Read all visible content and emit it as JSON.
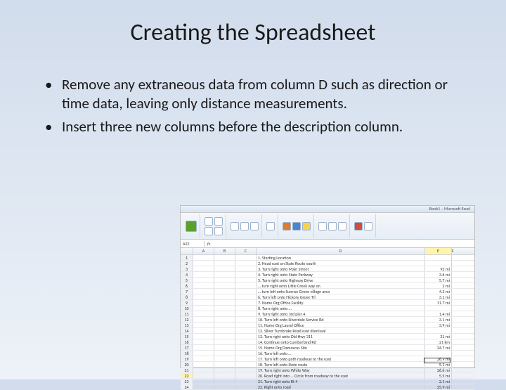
{
  "slide": {
    "title": "Creating the Spreadsheet",
    "bullets": [
      "Remove any extraneous data from column D such as direction or time data, leaving only distance measurements.",
      "Insert three new columns before the description column."
    ]
  },
  "excel": {
    "titlebar": "Book1 – Microsoft Excel",
    "namebox": "A22",
    "fx": "fx",
    "columns": [
      "A",
      "B",
      "C",
      "D",
      "E",
      "F"
    ],
    "rows": [
      {
        "n": "1",
        "d": "1. Starting Location",
        "e": ""
      },
      {
        "n": "2",
        "d": "2. Head east on State Route south",
        "e": ""
      },
      {
        "n": "3",
        "d": "3. Turn right onto Main Street",
        "e": "92 mi"
      },
      {
        "n": "4",
        "d": "4. Turn right onto State Parkway",
        "e": "3.6 mi"
      },
      {
        "n": "5",
        "d": "5. Turn right onto Highway Drive",
        "e": "5.7 mi"
      },
      {
        "n": "6",
        "d": "… turn right onto Little Creek way on",
        "e": "2 mi"
      },
      {
        "n": "7",
        "d": "… turn left onto Sunrise Grove village area",
        "e": "4.3 mi"
      },
      {
        "n": "8",
        "d": "6. Turn left onto Hickory Grove Trl",
        "e": "3.1 mi"
      },
      {
        "n": "9",
        "d": "7. Name Org Office Facility",
        "e": "11.7 mi"
      },
      {
        "n": "10",
        "d": "8. Turn right onto …",
        "e": ""
      },
      {
        "n": "11",
        "d": "9. Turn right onto 3rd pier 4",
        "e": "1.4 mi"
      },
      {
        "n": "12",
        "d": "10. Turn left onto Silverdale Service Rd",
        "e": "3.1 mi"
      },
      {
        "n": "13",
        "d": "11. Name Org Laurel Office",
        "e": "3.9 mi"
      },
      {
        "n": "14",
        "d": "12. Silver Turnbrake Road east dismissal",
        "e": ""
      },
      {
        "n": "15",
        "d": "13. Turn right onto Old Hwy 311",
        "e": "21 mi"
      },
      {
        "n": "16",
        "d": "14. Continue onto Cumberland Rd",
        "e": "21 km"
      },
      {
        "n": "17",
        "d": "15. Name Org Damascus Site",
        "e": "24.7 mi"
      },
      {
        "n": "18",
        "d": "16. Turn left onto …",
        "e": ""
      },
      {
        "n": "19",
        "d": "17. Turn left onto path roadway to the east",
        "e": "26.9 mi"
      },
      {
        "n": "20",
        "d": "18. Turn left onto State route",
        "e": "5.1 mi"
      },
      {
        "n": "21",
        "d": "19. Turn right onto White Way",
        "e": "26.6 mi"
      },
      {
        "n": "22",
        "d": "20. Road right into … Circle from roadway to the east",
        "e": "5.5 mi"
      },
      {
        "n": "23",
        "d": "21. Turn right onto Rt 4",
        "e": "2.1 mi"
      },
      {
        "n": "24",
        "d": "22. Right onto road",
        "e": "25.9 mi"
      }
    ]
  }
}
